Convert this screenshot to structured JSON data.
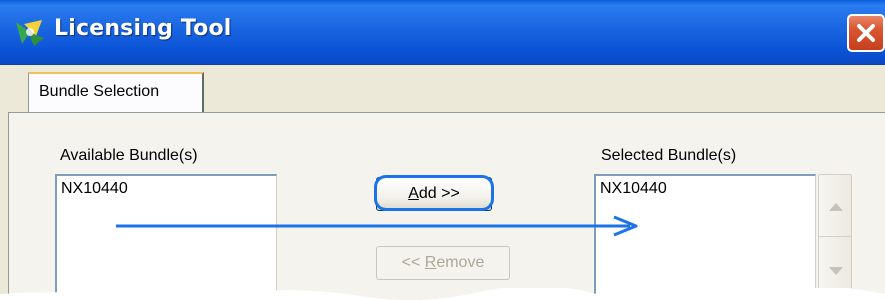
{
  "window": {
    "title": "Licensing Tool",
    "icons": {
      "app": "app-logo-icon",
      "close": "close-icon"
    }
  },
  "tabs": [
    {
      "label": "Bundle Selection",
      "selected": true
    }
  ],
  "available": {
    "label": "Available Bundle(s)",
    "items": [
      "NX10440"
    ]
  },
  "selected": {
    "label": "Selected Bundle(s)",
    "items": [
      "NX10440"
    ]
  },
  "buttons": {
    "add": {
      "label": "Add >>",
      "mnemonic": "A",
      "rest": "dd >>"
    },
    "remove": {
      "label": "<< Remove",
      "prefix": "<< ",
      "mnemonic": "R",
      "rest": "emove",
      "enabled": false
    }
  },
  "colors": {
    "title_bar": "#0a52d6",
    "close": "#d9552f",
    "annotation": "#1a73e8"
  }
}
